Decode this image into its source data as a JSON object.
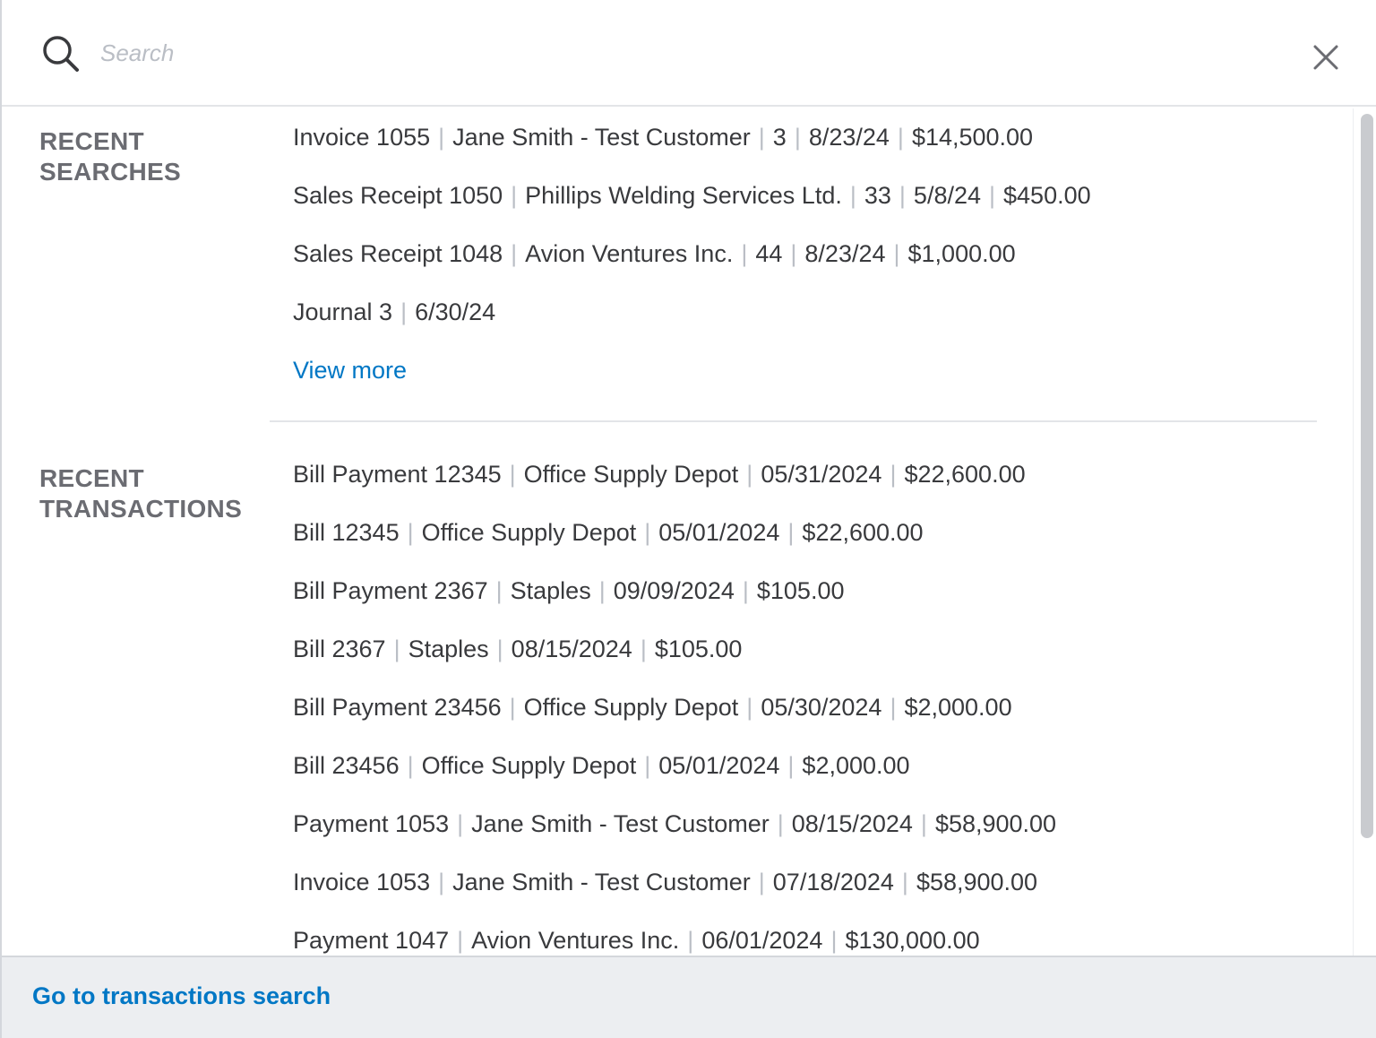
{
  "search": {
    "placeholder": "Search",
    "value": "",
    "icon": "search-icon",
    "close_icon": "close-icon"
  },
  "recent_searches": {
    "label_line1": "RECENT",
    "label_line2": "SEARCHES",
    "items": [
      [
        "Invoice 1055",
        "Jane Smith - Test Customer",
        "3",
        "8/23/24",
        "$14,500.00"
      ],
      [
        "Sales Receipt 1050",
        "Phillips Welding Services Ltd.",
        "33",
        "5/8/24",
        "$450.00"
      ],
      [
        "Sales Receipt 1048",
        "Avion Ventures Inc.",
        "44",
        "8/23/24",
        "$1,000.00"
      ],
      [
        "Journal 3",
        "6/30/24"
      ]
    ],
    "view_more": "View more"
  },
  "recent_transactions": {
    "label_line1": "RECENT",
    "label_line2": "TRANSACTIONS",
    "items": [
      [
        "Bill Payment 12345",
        "Office Supply Depot",
        "05/31/2024",
        "$22,600.00"
      ],
      [
        "Bill 12345",
        "Office Supply Depot",
        "05/01/2024",
        "$22,600.00"
      ],
      [
        "Bill Payment 2367",
        "Staples",
        "09/09/2024",
        "$105.00"
      ],
      [
        "Bill 2367",
        "Staples",
        "08/15/2024",
        "$105.00"
      ],
      [
        "Bill Payment 23456",
        "Office Supply Depot",
        "05/30/2024",
        "$2,000.00"
      ],
      [
        "Bill 23456",
        "Office Supply Depot",
        "05/01/2024",
        "$2,000.00"
      ],
      [
        "Payment 1053",
        "Jane Smith - Test Customer",
        "08/15/2024",
        "$58,900.00"
      ],
      [
        "Invoice 1053",
        "Jane Smith - Test Customer",
        "07/18/2024",
        "$58,900.00"
      ],
      [
        "Payment 1047",
        "Avion Ventures Inc.",
        "06/01/2024",
        "$130,000.00"
      ]
    ]
  },
  "footer": {
    "link_label": "Go to transactions search"
  },
  "colors": {
    "link": "#0077c5",
    "text": "#393a3d",
    "label": "#6b6c72",
    "separator": "#babec5",
    "footer_bg": "#eceef1"
  }
}
